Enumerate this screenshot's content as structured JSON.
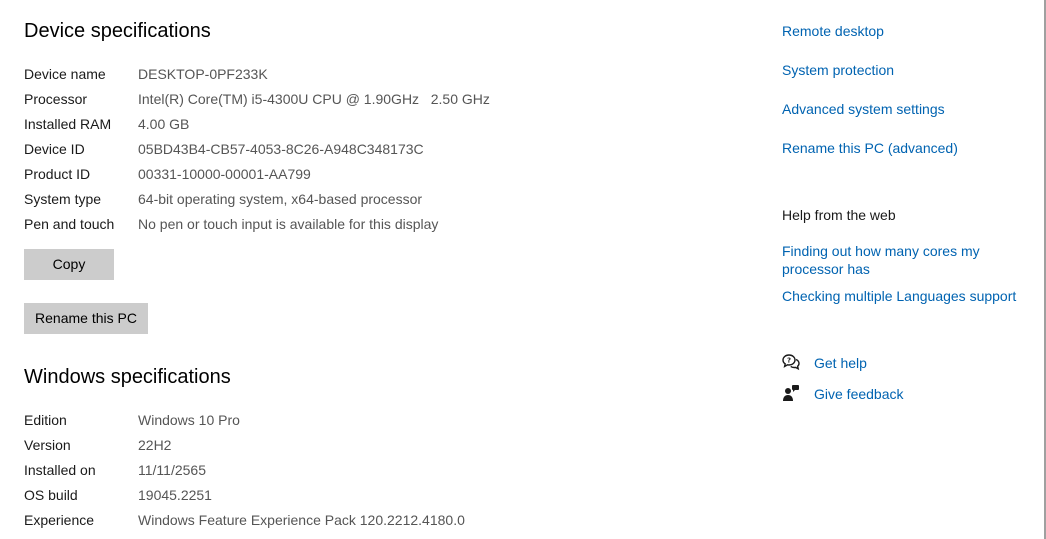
{
  "device_specs": {
    "title": "Device specifications",
    "rows": [
      {
        "label": "Device name",
        "value": "DESKTOP-0PF233K"
      },
      {
        "label": "Processor",
        "value": "Intel(R) Core(TM) i5-4300U CPU @ 1.90GHz   2.50 GHz"
      },
      {
        "label": "Installed RAM",
        "value": "4.00 GB"
      },
      {
        "label": "Device ID",
        "value": "05BD43B4-CB57-4053-8C26-A948C348173C"
      },
      {
        "label": "Product ID",
        "value": "00331-10000-00001-AA799"
      },
      {
        "label": "System type",
        "value": "64-bit operating system, x64-based processor"
      },
      {
        "label": "Pen and touch",
        "value": "No pen or touch input is available for this display"
      }
    ],
    "copy_label": "Copy",
    "rename_label": "Rename this PC"
  },
  "windows_specs": {
    "title": "Windows specifications",
    "rows": [
      {
        "label": "Edition",
        "value": "Windows 10 Pro"
      },
      {
        "label": "Version",
        "value": "22H2"
      },
      {
        "label": "Installed on",
        "value": "11/11/2565"
      },
      {
        "label": "OS build",
        "value": "19045.2251"
      },
      {
        "label": "Experience",
        "value": "Windows Feature Experience Pack 120.2212.4180.0"
      }
    ]
  },
  "related_links": {
    "remote_desktop": "Remote desktop",
    "system_protection": "System protection",
    "advanced_settings": "Advanced system settings",
    "rename_advanced": "Rename this PC (advanced)"
  },
  "help_web": {
    "heading": "Help from the web",
    "cores_link": "Finding out how many cores my processor has",
    "languages_link": "Checking multiple Languages support"
  },
  "support": {
    "get_help": "Get help",
    "give_feedback": "Give feedback"
  },
  "colors": {
    "link": "#0063b1",
    "button": "#cccccc",
    "value_text": "#555555"
  },
  "icons": {
    "get_help": "chat-help-icon",
    "give_feedback": "feedback-person-icon"
  }
}
